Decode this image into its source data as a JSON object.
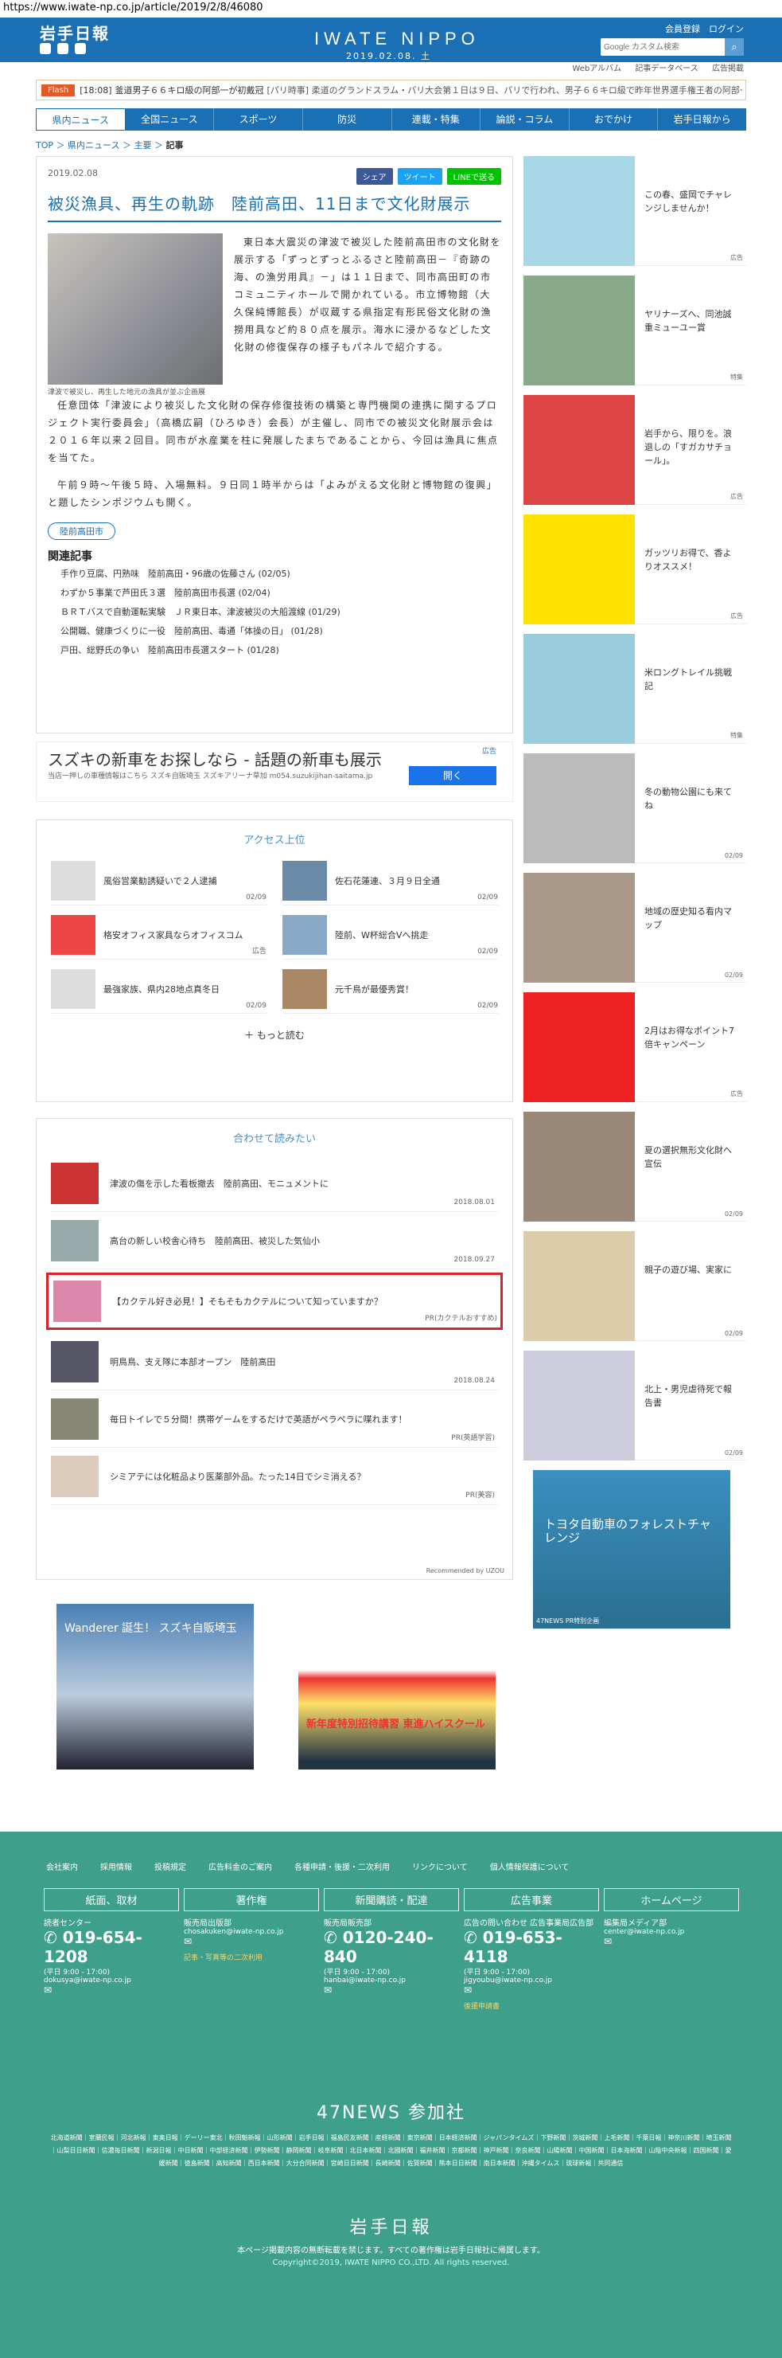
{
  "url": "https://www.iwate-np.co.jp/article/2019/2/8/46080",
  "header": {
    "logo": "岩手日報",
    "brand": "IWATE NIPPO",
    "date": "2019.02.08. 土",
    "links": "会員登録　ログイン",
    "search_placeholder": "Google カスタム検索"
  },
  "subnav": [
    "Webアルバム",
    "記事データベース",
    "広告掲載"
  ],
  "flash": {
    "tag": "Flash",
    "time": "[18:08]",
    "text1": "釜道男子６６キロ級の阿部一が初戴冠",
    "text2": "[パリ時事] 柔道のグランドスラム・パリ大会第１日は９日、パリで行われ、男子６６キロ級で昨年世界選手権王者の阿部一二三"
  },
  "nav": [
    "県内ニュース",
    "全国ニュース",
    "スポーツ",
    "防災",
    "連載・特集",
    "論説・コラム",
    "おでかけ",
    "岩手日報から"
  ],
  "crumb": {
    "top": "TOP",
    "a": "県内ニュース",
    "b": "主要",
    "c": "記事"
  },
  "article": {
    "date": "2019.02.08",
    "share": [
      "シェア",
      "ツイート",
      "LINEで送る"
    ],
    "title": "被災漁具、再生の軌跡　陸前高田、11日まで文化財展示",
    "caption": "津波で被災し、再生した地元の漁具が並ぶ企画展",
    "p1": "東日本大震災の津波で被災した陸前高田市の文化財を展示する「ずっとずっとふるさと陸前高田－『奇跡の海、の漁労用具』－」は１１日まで、同市高田町の市コミュニティホールで開かれている。市立博物館（大久保純博館長）が収蔵する県指定有形民俗文化財の漁撈用具など約８０点を展示。海水に浸かるなどした文化財の修復保存の様子もパネルで紹介する。",
    "p2": "任意団体「津波により被災した文化財の保存修復技術の構築と専門機関の連携に関するプロジェクト実行委員会」（高橋広嗣（ひろゆき）会長）が主催し、同市での被災文化財展示会は２０１６年以来２回目。同市が水産業を柱に発展したまちであることから、今回は漁具に焦点を当てた。",
    "p3": "午前９時～午後５時、入場無料。９日同１時半からは「よみがえる文化財と博物館の復興」と題したシンポジウムも開く。",
    "tag": "陸前高田市",
    "relh": "関連記事",
    "related": [
      "手作り豆腐、円熟味　陸前高田・96歳の佐藤さん (02/05)",
      "わずか５事業で芦田氏３選　陸前高田市長選 (02/04)",
      "ＢＲＴバスで自動運転実験　ＪＲ東日本、津波被災の大船渡線 (01/29)",
      "公開職、健康づくりに一役　陸前高田、毒通「体操の日」 (01/28)",
      "戸田、総野氏の争い　陸前高田市長選スタート (01/28)"
    ]
  },
  "ad1": {
    "title": "スズキの新車をお探しなら - 話題の新車も展示",
    "desc": "当店一押しの車種情報はこちら スズキ自販埼玉 スズキアリーナ草加 m054.suzukijihan-saitama.jp",
    "btn": "開く",
    "label": "広告"
  },
  "access": {
    "heading": "アクセス上位",
    "items": [
      {
        "t": "風俗営業勧誘疑いで２人逮捕",
        "d": "02/09"
      },
      {
        "t": "佐石花蓮連、３月９日全通",
        "d": "02/09"
      },
      {
        "t": "格安オフィス家具ならオフィスコム",
        "d": "広告"
      },
      {
        "t": "陸前、W杯総合Vへ挑走",
        "d": "02/09"
      },
      {
        "t": "最強家族、県内28地点真冬日",
        "d": "02/09"
      },
      {
        "t": "元千鳥が最優秀賞！",
        "d": "02/09"
      }
    ],
    "more": "もっと読む"
  },
  "related2": {
    "heading": "合わせて読みたい",
    "items": [
      {
        "t": "津波の傷を示した看板撤去　陸前高田、モニュメントに",
        "d": "2018.08.01"
      },
      {
        "t": "高台の新しい校舎心待ち　陸前高田、被災した気仙小",
        "d": "2018.09.27"
      },
      {
        "t": "【カクテル好き必見！】そもそもカクテルについて知っていますか？",
        "d": "PR(カクテルおすすめ)"
      },
      {
        "t": "明鳥鳥、支え隊に本部オープン　陸前高田",
        "d": "2018.08.24"
      },
      {
        "t": "毎日トイレで５分間！携帯ゲームをするだけで英語がペラペラに喋れます！",
        "d": "PR(英語学習)"
      },
      {
        "t": "シミアテには化粧品より医薬部外品。たった14日でシミ消える？",
        "d": "PR(美容)"
      }
    ],
    "recby": "Recommended by UZOU"
  },
  "ads2": {
    "a": "Wanderer 誕生！ スズキ自販埼玉",
    "b": "新年度特別招待講習 東進ハイスクール"
  },
  "right": [
    {
      "t": "この春、盛岡でチャレンジしませんか！",
      "l": "広告"
    },
    {
      "t": "ヤリナーズへ、同池誠重ミューユー賞",
      "l": "特集"
    },
    {
      "t": "岩手から、限りを。浪退しの「すガカサチョール」。",
      "l": "広告"
    },
    {
      "t": "ガッツリお得で、香よりオススメ！",
      "l": "広告"
    },
    {
      "t": "米ロングトレイル挑戦記",
      "l": "特集"
    },
    {
      "t": "冬の動物公園にも来てね",
      "l": "02/09"
    },
    {
      "t": "地域の歴史知る看内マップ",
      "l": "02/09"
    },
    {
      "t": "2月はお得なポイント7倍キャンペーン",
      "l": "広告"
    },
    {
      "t": "夏の選択無形文化財へ宣伝",
      "l": "02/09"
    },
    {
      "t": "親子の遊び場、実家に",
      "l": "02/09"
    },
    {
      "t": "北上・男児虐待死で報告書",
      "l": "02/09"
    },
    {
      "t": "トヨタ自動車のフォレストチャレンジ",
      "l": "47NEWS PR特別企画"
    }
  ],
  "footer": {
    "links": [
      "会社案内",
      "採用情報",
      "投稿規定",
      "広告料金のご案内",
      "各種申請・後援・二次利用",
      "リンクについて",
      "個人情報保護について"
    ],
    "cols": [
      {
        "h": "紙面、取材",
        "s": "読者センター",
        "p": "019-654-1208",
        "sm": "(平日 9:00 - 17:00)",
        "m": "dokusya@iwate-np.co.jp",
        "lk": ""
      },
      {
        "h": "著作権",
        "s": "販売局出版部",
        "p": "",
        "sm": "",
        "m": "chosakuken@iwate-np.co.jp",
        "lk": "記事・写真等の二次利用"
      },
      {
        "h": "新聞購読・配達",
        "s": "販売局販売部",
        "p": "0120-240-840",
        "sm": "(平日 9:00 - 17:00)",
        "m": "hanbai@iwate-np.co.jp",
        "lk": ""
      },
      {
        "h": "広告事業",
        "s": "広告の問い合わせ 広告事業局広告部",
        "p": "019-653-4118",
        "sm": "(平日 9:00 - 17:00)",
        "m": "jigyoubu@iwate-np.co.jp",
        "lk": "後援申請書"
      },
      {
        "h": "ホームページ",
        "s": "編集局メディア部",
        "p": "",
        "sm": "",
        "m": "center@iwate-np.co.jp",
        "lk": ""
      }
    ],
    "n47": "47NEWS 参加社",
    "papers": "北海道新聞｜室蘭民報｜河北新報｜東奥日報｜デーリー東北｜秋田魁新報｜山形新聞｜岩手日報｜福島民友新聞｜産経新聞｜東京新聞｜日本経済新聞｜ジャパンタイムズ｜下野新聞｜茨城新聞｜上毛新聞｜千葉日報｜神奈川新聞｜埼玉新聞｜山梨日日新聞｜信濃毎日新聞｜新潟日報｜中日新聞｜中部経済新聞｜伊勢新聞｜静岡新聞｜岐阜新聞｜北日本新聞｜北國新聞｜福井新聞｜京都新聞｜神戸新聞｜奈良新聞｜山陽新聞｜中国新聞｜日本海新聞｜山陰中央新報｜四国新聞｜愛媛新聞｜徳島新聞｜高知新聞｜西日本新聞｜大分合同新聞｜宮崎日日新聞｜長崎新聞｜佐賀新聞｜熊本日日新聞｜南日本新聞｜沖縄タイムス｜琉球新報｜共同通信",
    "logo": "岩手日報",
    "note": "本ページ掲載内容の無断転載を禁じます。すべての著作権は岩手日報社に帰属します。",
    "copy": "Copyright©2019, IWATE NIPPO CO.,LTD. All rights reserved."
  }
}
